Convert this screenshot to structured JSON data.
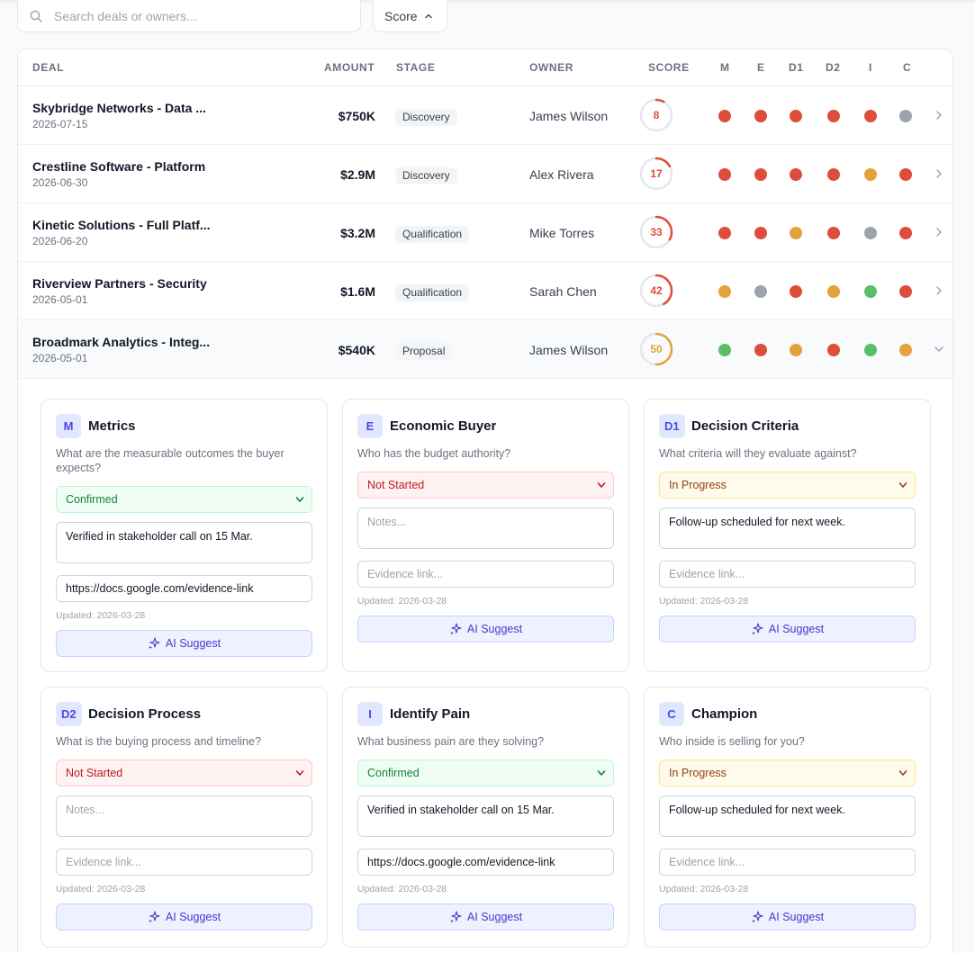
{
  "search": {
    "placeholder": "Search deals or owners..."
  },
  "sort": {
    "label": "Score"
  },
  "columns": {
    "deal": "DEAL",
    "amount": "AMOUNT",
    "stage": "STAGE",
    "owner": "OWNER",
    "score": "SCORE",
    "m": "M",
    "e": "E",
    "d1": "D1",
    "d2": "D2",
    "i": "I",
    "c": "C"
  },
  "colors": {
    "red": "#dc4e3b",
    "amber": "#e3a23a",
    "green": "#5cbd68",
    "gray": "#9ca3af"
  },
  "deals": [
    {
      "name": "Skybridge Networks - Data ...",
      "date": "2026-07-15",
      "amount": "$750K",
      "stage": "Discovery",
      "owner": "James Wilson",
      "score": "8",
      "score_value": 8,
      "score_color": "#dc4e3b",
      "dots": [
        "red",
        "red",
        "red",
        "red",
        "red",
        "gray"
      ]
    },
    {
      "name": "Crestline Software - Platform",
      "date": "2026-06-30",
      "amount": "$2.9M",
      "stage": "Discovery",
      "owner": "Alex Rivera",
      "score": "17",
      "score_value": 17,
      "score_color": "#dc4e3b",
      "dots": [
        "red",
        "red",
        "red",
        "red",
        "amber",
        "red"
      ]
    },
    {
      "name": "Kinetic Solutions - Full Platf...",
      "date": "2026-06-20",
      "amount": "$3.2M",
      "stage": "Qualification",
      "owner": "Mike Torres",
      "score": "33",
      "score_value": 33,
      "score_color": "#dc4e3b",
      "dots": [
        "red",
        "red",
        "amber",
        "red",
        "gray",
        "red"
      ]
    },
    {
      "name": "Riverview Partners - Security",
      "date": "2026-05-01",
      "amount": "$1.6M",
      "stage": "Qualification",
      "owner": "Sarah Chen",
      "score": "42",
      "score_value": 42,
      "score_color": "#dc4e3b",
      "dots": [
        "amber",
        "gray",
        "red",
        "amber",
        "green",
        "red"
      ]
    },
    {
      "name": "Broadmark Analytics - Integ...",
      "date": "2026-05-01",
      "amount": "$540K",
      "stage": "Proposal",
      "owner": "James Wilson",
      "score": "50",
      "score_value": 50,
      "score_color": "#e3a23a",
      "dots": [
        "green",
        "red",
        "amber",
        "red",
        "green",
        "amber"
      ]
    }
  ],
  "cards": [
    {
      "badge": "M",
      "title": "Metrics",
      "question": "What are the measurable outcomes the buyer expects?",
      "status": "Confirmed",
      "status_key": "confirmed",
      "notes": "Verified in stakeholder call on 15 Mar.",
      "notes_placeholder": "Notes...",
      "evidence": "https://docs.google.com/evidence-link",
      "evidence_placeholder": "Evidence link...",
      "updated": "Updated: 2026-03-28",
      "ai_label": "AI Suggest"
    },
    {
      "badge": "E",
      "title": "Economic Buyer",
      "question": "Who has the budget authority?",
      "status": "Not Started",
      "status_key": "notstarted",
      "notes": "",
      "notes_placeholder": "Notes...",
      "evidence": "",
      "evidence_placeholder": "Evidence link...",
      "updated": "Updated: 2026-03-28",
      "ai_label": "AI Suggest"
    },
    {
      "badge": "D1",
      "title": "Decision Criteria",
      "question": "What criteria will they evaluate against?",
      "status": "In Progress",
      "status_key": "inprogress",
      "notes": "Follow-up scheduled for next week.",
      "notes_placeholder": "Notes...",
      "evidence": "",
      "evidence_placeholder": "Evidence link...",
      "updated": "Updated: 2026-03-28",
      "ai_label": "AI Suggest"
    },
    {
      "badge": "D2",
      "title": "Decision Process",
      "question": "What is the buying process and timeline?",
      "status": "Not Started",
      "status_key": "notstarted",
      "notes": "",
      "notes_placeholder": "Notes...",
      "evidence": "",
      "evidence_placeholder": "Evidence link...",
      "updated": "Updated: 2026-03-28",
      "ai_label": "AI Suggest"
    },
    {
      "badge": "I",
      "title": "Identify Pain",
      "question": "What business pain are they solving?",
      "status": "Confirmed",
      "status_key": "confirmed",
      "notes": "Verified in stakeholder call on 15 Mar.",
      "notes_placeholder": "Notes...",
      "evidence": "https://docs.google.com/evidence-link",
      "evidence_placeholder": "Evidence link...",
      "updated": "Updated: 2026-03-28",
      "ai_label": "AI Suggest"
    },
    {
      "badge": "C",
      "title": "Champion",
      "question": "Who inside is selling for you?",
      "status": "In Progress",
      "status_key": "inprogress",
      "notes": "Follow-up scheduled for next week.",
      "notes_placeholder": "Notes...",
      "evidence": "",
      "evidence_placeholder": "Evidence link...",
      "updated": "Updated: 2026-03-28",
      "ai_label": "AI Suggest"
    }
  ]
}
